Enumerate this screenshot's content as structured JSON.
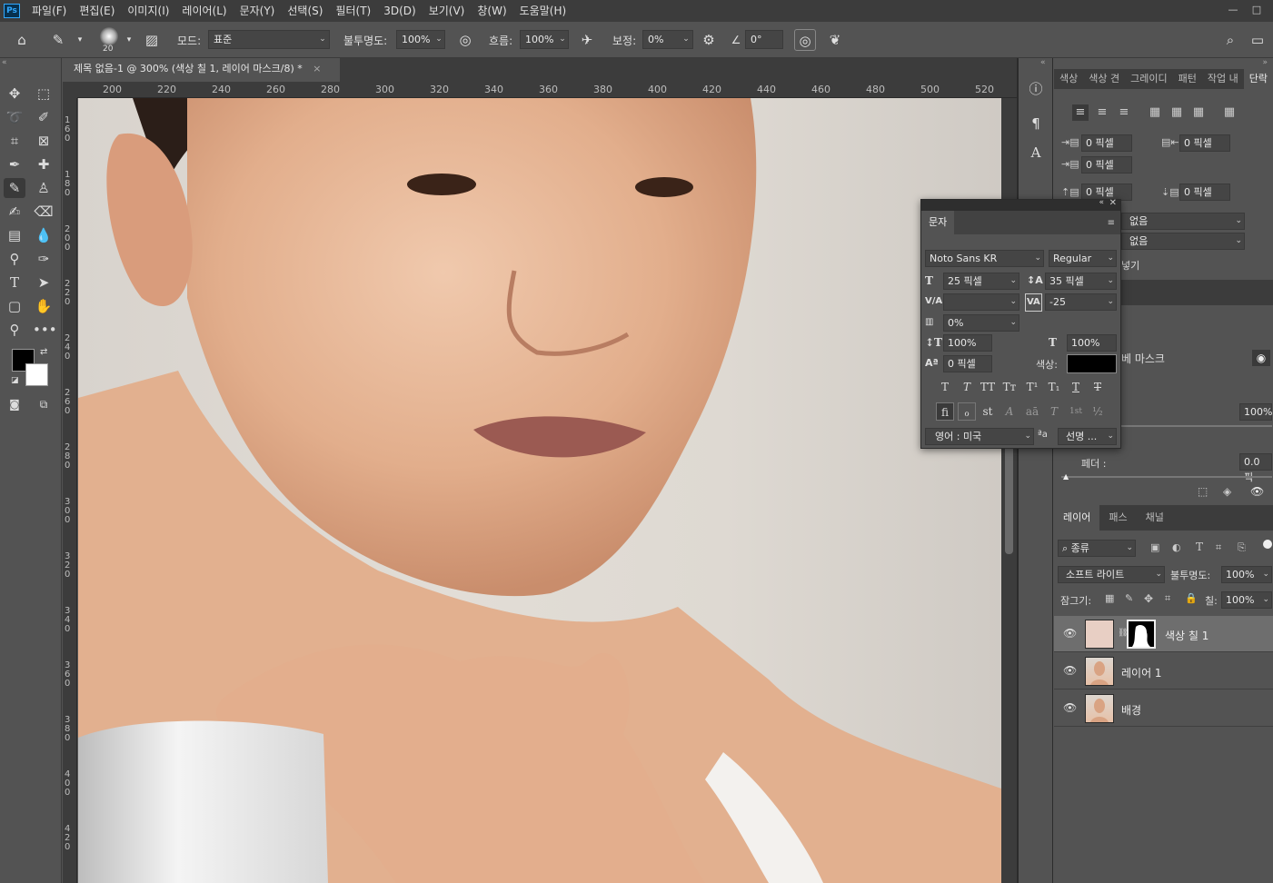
{
  "app": {
    "logo": "Ps"
  },
  "menu": [
    "파일(F)",
    "편집(E)",
    "이미지(I)",
    "레이어(L)",
    "문자(Y)",
    "선택(S)",
    "필터(T)",
    "3D(D)",
    "보기(V)",
    "창(W)",
    "도움말(H)"
  ],
  "window": {
    "minimize": "—",
    "maximize": "□"
  },
  "options": {
    "brush_size": "20",
    "mode_label": "모드:",
    "mode_value": "표준",
    "opacity_label": "불투명도:",
    "opacity_value": "100%",
    "flow_label": "흐름:",
    "flow_value": "100%",
    "smoothing_label": "보정:",
    "smoothing_value": "0%",
    "angle_value": "0°"
  },
  "document": {
    "tab_title": "제목 없음-1 @ 300% (색상 칠 1, 레이어 마스크/8) *",
    "close": "×",
    "ruler_h": [
      "200",
      "220",
      "240",
      "260",
      "280",
      "300",
      "320",
      "340",
      "360",
      "380",
      "400",
      "420",
      "440",
      "460",
      "480",
      "500",
      "520"
    ],
    "ruler_v": [
      "160",
      "180",
      "200",
      "220",
      "240",
      "260",
      "280",
      "300",
      "320",
      "340",
      "360",
      "380",
      "400",
      "420"
    ]
  },
  "paragraph_panel": {
    "tabs": [
      "색상",
      "색상 견",
      "그레이디",
      "패턴",
      "작업 내",
      "단락"
    ],
    "active_tab": "단락",
    "indent_left": "0 픽셀",
    "indent_right": "0 픽셀",
    "indent_first": "0 픽셀",
    "space_before": "0 픽셀",
    "space_after": "0 픽셀",
    "dropdown1": "없음",
    "dropdown2": "없음",
    "hyphenate_partial": "넣기",
    "mask_label_partial": "베 마스크",
    "density_value": "100%",
    "feather_label": "페더 :",
    "feather_value": "0.0 픽"
  },
  "character_panel": {
    "tab": "문자",
    "font_family": "Noto Sans KR",
    "font_style": "Regular",
    "font_size": "25 픽셀",
    "leading": "35 픽셀",
    "kerning": "",
    "tracking": "-25",
    "scale_percent": "0%",
    "vertical_scale": "100%",
    "horizontal_scale": "100%",
    "baseline_shift": "0 픽셀",
    "color_label": "색상:",
    "color_value": "#000000",
    "language": "영어 : 미국",
    "aa_label": "ªa",
    "antialias": "선명 ...",
    "style_buttons": [
      "T",
      "T",
      "TT",
      "Tт",
      "T¹",
      "T₁",
      "T",
      "T"
    ],
    "opentype_buttons": [
      "fi",
      "ℴ",
      "st",
      "A",
      "aā",
      "T",
      "1st",
      "½"
    ]
  },
  "layers_panel": {
    "tabs": [
      "레이어",
      "패스",
      "채널"
    ],
    "active_tab": "레이어",
    "filter_label": "종류",
    "blend_mode": "소프트 라이트",
    "opacity_label": "불투명도:",
    "opacity_value": "100%",
    "lock_label": "잠그기:",
    "fill_label": "칠:",
    "fill_value": "100%",
    "layers": [
      {
        "name": "색상 칠 1",
        "selected": true
      },
      {
        "name": "레이어 1",
        "selected": false
      },
      {
        "name": "배경",
        "selected": false
      }
    ]
  },
  "colors": {
    "foreground": "#000000",
    "background": "#ffffff",
    "fill_swatch": "#e8cfc4",
    "selected_layer": "#6e6e6e"
  }
}
